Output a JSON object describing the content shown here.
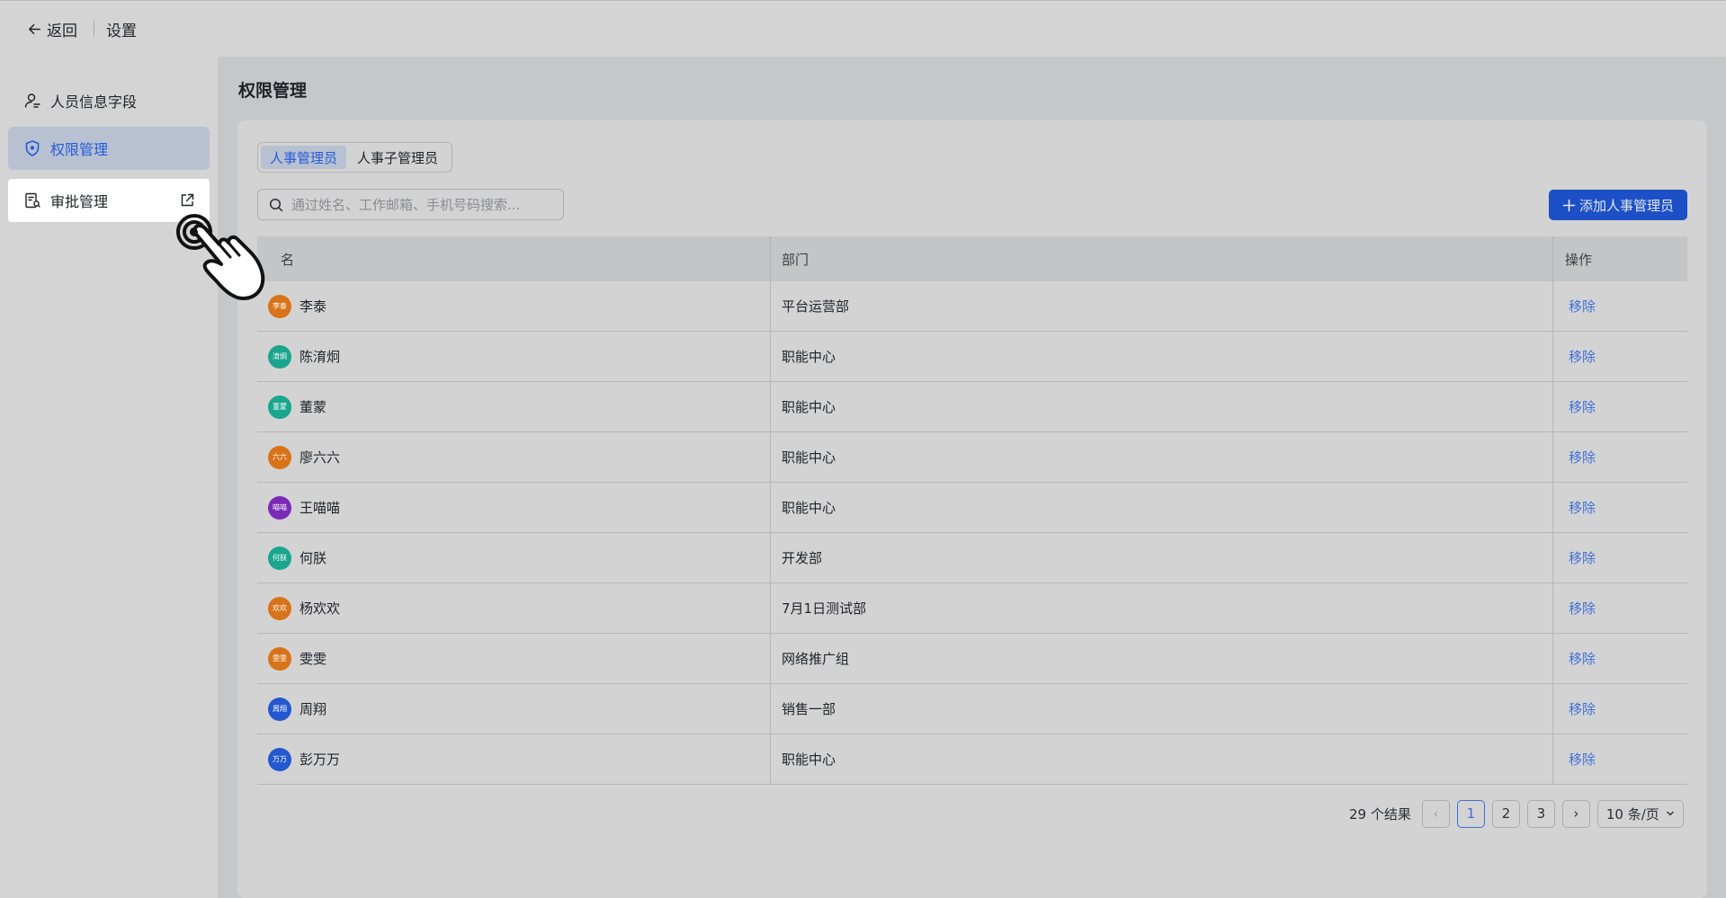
{
  "topbar": {
    "back_label": "返回",
    "title": "设置"
  },
  "sidebar": {
    "items": [
      {
        "label": "人员信息字段",
        "icon": "user-field-icon"
      },
      {
        "label": "权限管理",
        "icon": "shield-icon"
      },
      {
        "label": "审批管理",
        "icon": "approval-icon"
      }
    ]
  },
  "page": {
    "title": "权限管理"
  },
  "tabs": [
    {
      "label": "人事管理员"
    },
    {
      "label": "人事子管理员"
    }
  ],
  "search": {
    "placeholder": "通过姓名、工作邮箱、手机号码搜索..."
  },
  "add_button": {
    "label": "添加人事管理员"
  },
  "table": {
    "headers": {
      "name": "名",
      "department": "部门",
      "action": "操作"
    },
    "rows": [
      {
        "avatar_text": "李泰",
        "avatar_color": "#d9731a",
        "name": "李泰",
        "department": "平台运营部",
        "action": "移除"
      },
      {
        "avatar_text": "淯炯",
        "avatar_color": "#19a58e",
        "name": "陈淯炯",
        "department": "职能中心",
        "action": "移除"
      },
      {
        "avatar_text": "董蒙",
        "avatar_color": "#19a58e",
        "name": "董蒙",
        "department": "职能中心",
        "action": "移除"
      },
      {
        "avatar_text": "六六",
        "avatar_color": "#d9731a",
        "name": "廖六六",
        "department": "职能中心",
        "action": "移除"
      },
      {
        "avatar_text": "喵喵",
        "avatar_color": "#7b2ab8",
        "name": "王喵喵",
        "department": "职能中心",
        "action": "移除"
      },
      {
        "avatar_text": "何朕",
        "avatar_color": "#19a58e",
        "name": "何朕",
        "department": "开发部",
        "action": "移除"
      },
      {
        "avatar_text": "欢欢",
        "avatar_color": "#d9731a",
        "name": "杨欢欢",
        "department": "7月1日测试部",
        "action": "移除"
      },
      {
        "avatar_text": "雯雯",
        "avatar_color": "#d9731a",
        "name": "雯雯",
        "department": "网络推广组",
        "action": "移除"
      },
      {
        "avatar_text": "周翔",
        "avatar_color": "#2457d0",
        "name": "周翔",
        "department": "销售一部",
        "action": "移除"
      },
      {
        "avatar_text": "万万",
        "avatar_color": "#2457d0",
        "name": "彭万万",
        "department": "职能中心",
        "action": "移除"
      }
    ]
  },
  "pagination": {
    "total_text": "29 个结果",
    "prev_label": "‹",
    "pages": [
      "1",
      "2",
      "3"
    ],
    "current": "1",
    "next_label": "›",
    "page_size": "10 条/页"
  }
}
